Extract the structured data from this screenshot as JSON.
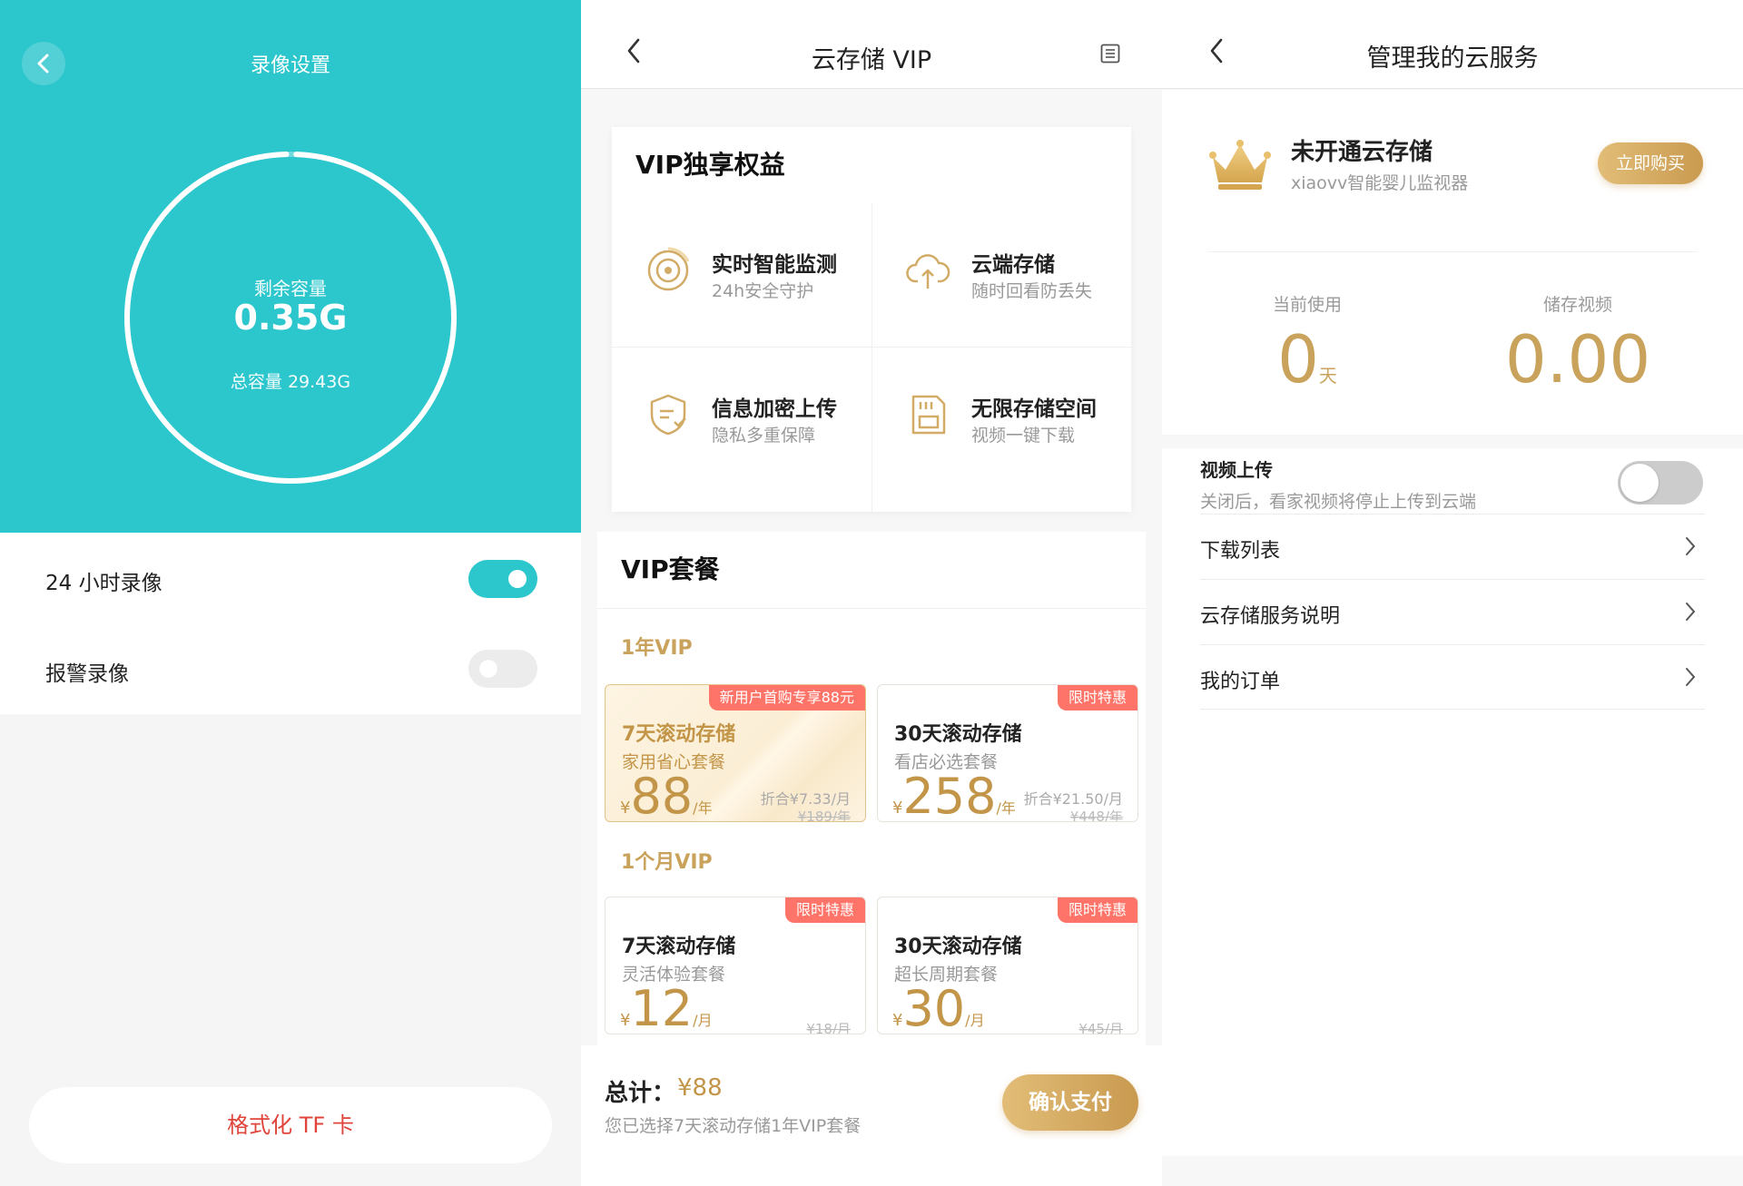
{
  "recording": {
    "title": "录像设置",
    "storage_label": "剩余容量",
    "remaining": "0.35G",
    "total": "总容量 29.43G",
    "used_fraction": 0.99,
    "rows": [
      {
        "label": "24 小时录像",
        "enabled": true
      },
      {
        "label": "报警录像",
        "enabled": false
      }
    ],
    "format_button": "格式化 TF 卡",
    "accent": "#2cc6cd"
  },
  "vip": {
    "title": "云存储 VIP",
    "benefits_title": "VIP独享权益",
    "benefits": [
      {
        "icon": "target-icon",
        "title": "实时智能监测",
        "subtitle": "24h安全守护"
      },
      {
        "icon": "cloud-upload-icon",
        "title": "云端存储",
        "subtitle": "随时回看防丢失"
      },
      {
        "icon": "shield-icon",
        "title": "信息加密上传",
        "subtitle": "隐私多重保障"
      },
      {
        "icon": "sd-card-icon",
        "title": "无限存储空间",
        "subtitle": "视频一键下载"
      }
    ],
    "plans_title": "VIP套餐",
    "groups": [
      {
        "title": "1年VIP",
        "plans": [
          {
            "badge": "新用户首购专享88元",
            "name": "7天滚动存储",
            "desc": "家用省心套餐",
            "currency": "¥",
            "price": "88",
            "unit": "/年",
            "equivalent": "折合¥7.33/月",
            "original": "¥189/年",
            "selected": true
          },
          {
            "badge": "限时特惠",
            "name": "30天滚动存储",
            "desc": "看店必选套餐",
            "currency": "¥",
            "price": "258",
            "unit": "/年",
            "equivalent": "折合¥21.50/月",
            "original": "¥448/年",
            "selected": false
          }
        ]
      },
      {
        "title": "1个月VIP",
        "plans": [
          {
            "badge": "限时特惠",
            "name": "7天滚动存储",
            "desc": "灵活体验套餐",
            "currency": "¥",
            "price": "12",
            "unit": "/月",
            "equivalent": "",
            "original": "¥18/月",
            "selected": false
          },
          {
            "badge": "限时特惠",
            "name": "30天滚动存储",
            "desc": "超长周期套餐",
            "currency": "¥",
            "price": "30",
            "unit": "/月",
            "equivalent": "",
            "original": "¥45/月",
            "selected": false
          }
        ]
      }
    ],
    "total_label": "总计：",
    "total_value": "¥88",
    "total_desc": "您已选择7天滚动存储1年VIP套餐",
    "pay_button": "确认支付",
    "gold": "#c39548",
    "badge_color": "#ff7468"
  },
  "manage": {
    "title": "管理我的云服务",
    "status": "未开通云存储",
    "device": "xiaovv智能婴儿监视器",
    "buy_button": "立即购买",
    "stats": [
      {
        "label": "当前使用",
        "value": "0",
        "unit": "天"
      },
      {
        "label": "储存视频",
        "value": "0.00",
        "unit": ""
      }
    ],
    "upload_title": "视频上传",
    "upload_desc": "关闭后，看家视频将停止上传到云端",
    "upload_enabled": false,
    "rows": [
      {
        "label": "下载列表"
      },
      {
        "label": "云存储服务说明"
      },
      {
        "label": "我的订单"
      }
    ]
  }
}
